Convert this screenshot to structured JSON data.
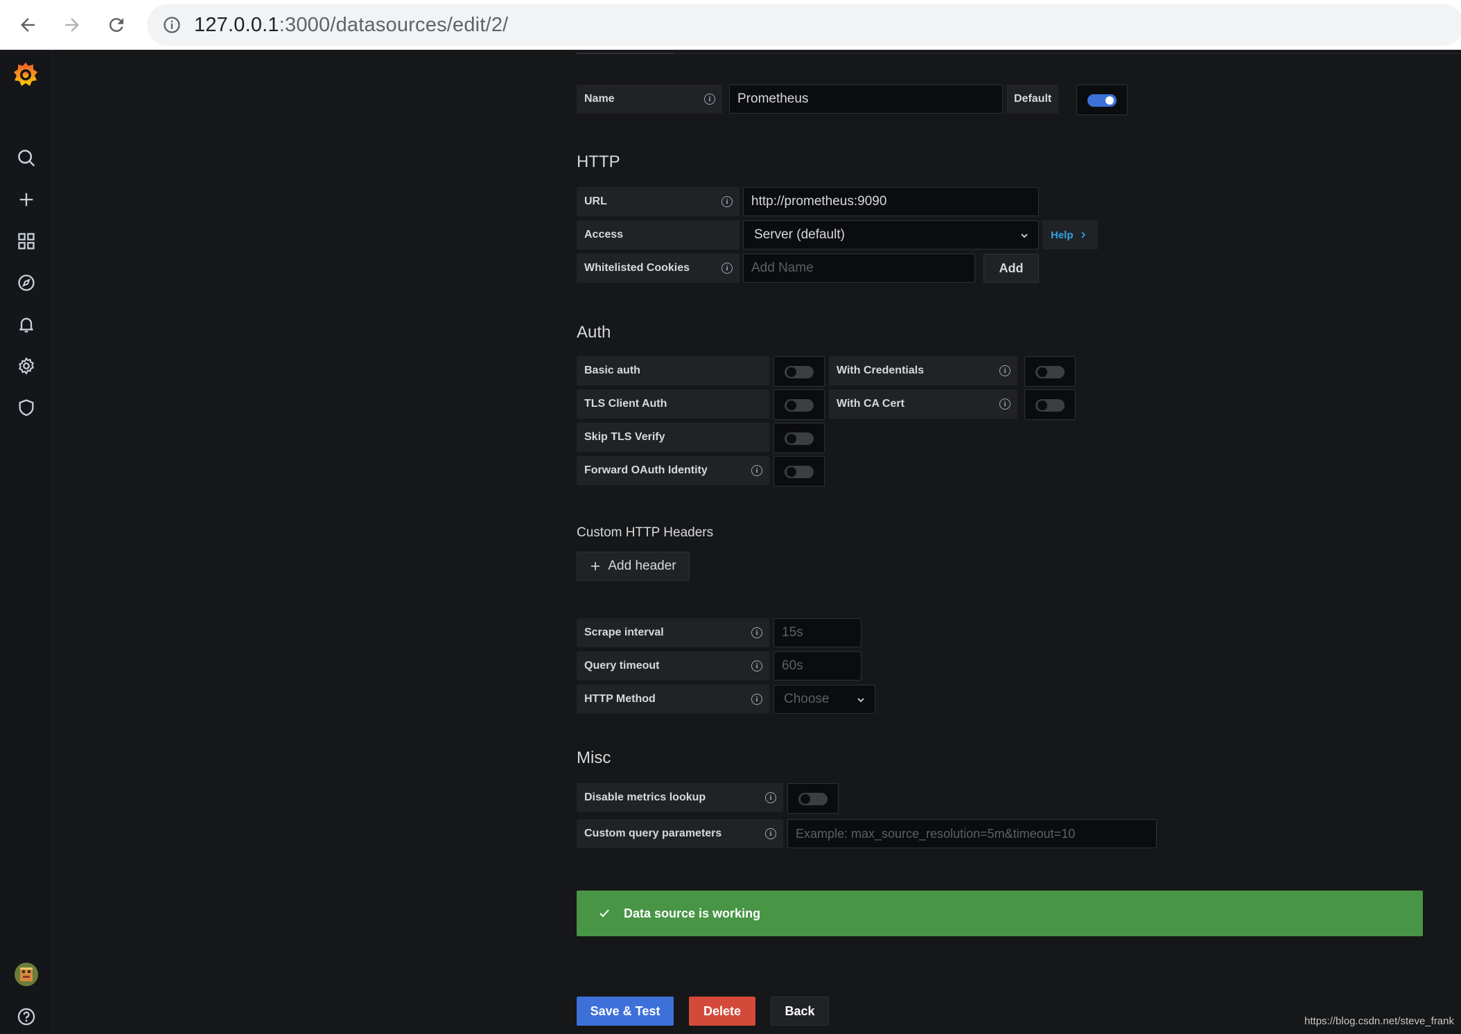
{
  "browser": {
    "url_host": "127.0.0.1",
    "url_path": ":3000/datasources/edit/2/"
  },
  "sidebar": {
    "icons": [
      "grafana-logo-icon",
      "search-icon",
      "plus-icon",
      "dashboards-icon",
      "explore-icon",
      "alerting-icon",
      "settings-icon",
      "shield-icon",
      "avatar",
      "help-icon"
    ]
  },
  "name_row": {
    "label": "Name",
    "value": "Prometheus",
    "default_label": "Default",
    "default_on": true
  },
  "http": {
    "title": "HTTP",
    "url_label": "URL",
    "url_value": "http://prometheus:9090",
    "access_label": "Access",
    "access_value": "Server (default)",
    "help_label": "Help",
    "cookies_label": "Whitelisted Cookies",
    "cookies_placeholder": "Add Name",
    "add_label": "Add"
  },
  "auth": {
    "title": "Auth",
    "basic_auth": "Basic auth",
    "with_credentials": "With Credentials",
    "tls_client_auth": "TLS Client Auth",
    "with_ca_cert": "With CA Cert",
    "skip_tls_verify": "Skip TLS Verify",
    "forward_oauth": "Forward OAuth Identity"
  },
  "headers": {
    "title": "Custom HTTP Headers",
    "add_header_label": "Add header"
  },
  "prom": {
    "scrape_label": "Scrape interval",
    "scrape_placeholder": "15s",
    "timeout_label": "Query timeout",
    "timeout_placeholder": "60s",
    "method_label": "HTTP Method",
    "method_placeholder": "Choose"
  },
  "misc": {
    "title": "Misc",
    "disable_metrics_label": "Disable metrics lookup",
    "custom_query_label": "Custom query parameters",
    "custom_query_placeholder": "Example: max_source_resolution=5m&timeout=10"
  },
  "alert": {
    "message": "Data source is working"
  },
  "actions": {
    "save_test": "Save & Test",
    "delete": "Delete",
    "back": "Back"
  },
  "watermark": "https://blog.csdn.net/steve_frank",
  "colors": {
    "accent": "#3d71d9",
    "success": "#489545",
    "danger": "#d44a3a",
    "background": "#161719"
  }
}
